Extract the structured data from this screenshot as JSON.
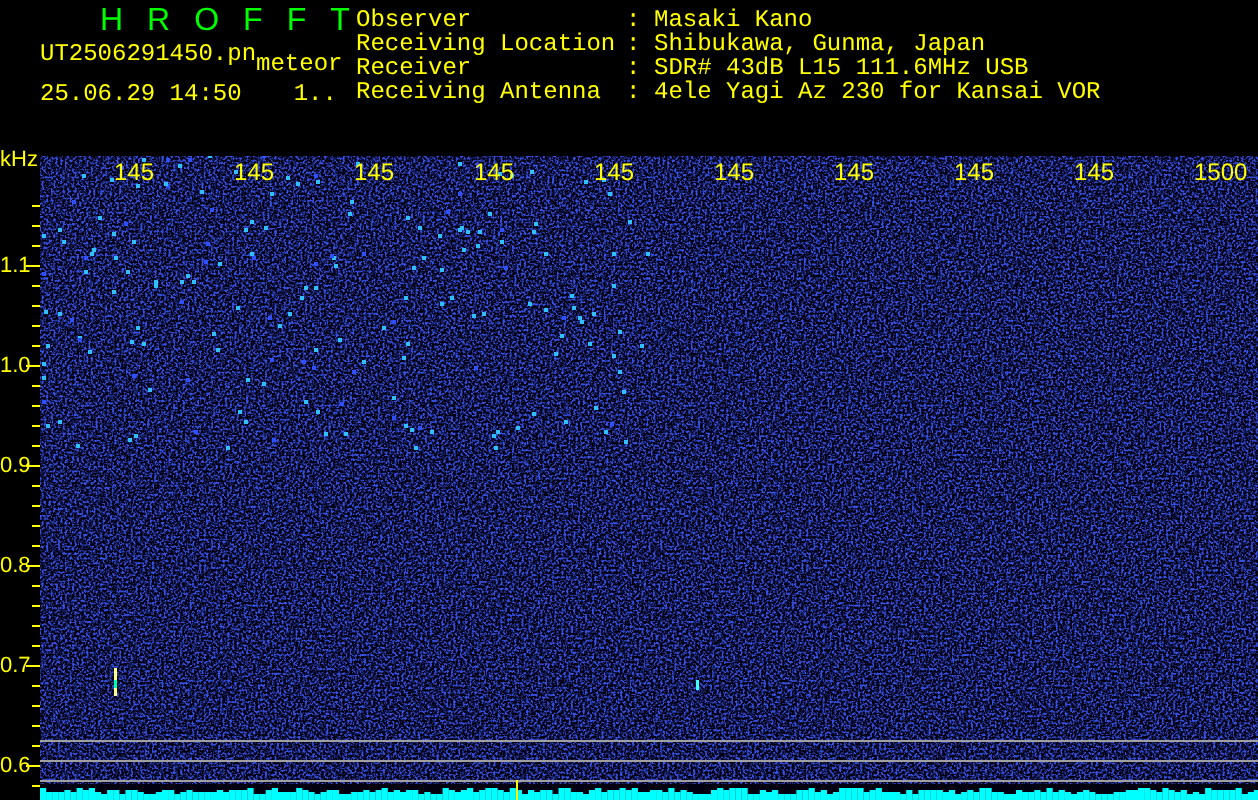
{
  "app_title": "HROFFT",
  "file": {
    "name": "UT2506291450.pn",
    "tag": "meteor",
    "datetime": "25.06.29 14:50",
    "counter": "1.."
  },
  "info": [
    {
      "label": "Observer",
      "colon": ":",
      "value": "Masaki Kano"
    },
    {
      "label": "Receiving Location",
      "colon": ":",
      "value": "Shibukawa, Gunma, Japan"
    },
    {
      "label": "Receiver",
      "colon": ":",
      "value": "SDR# 43dB L15 111.6MHz USB"
    },
    {
      "label": "Receiving Antenna",
      "colon": ":",
      "value": "4ele Yagi Az 230 for Kansai VOR"
    }
  ],
  "x_axis": {
    "unit": "kHz",
    "ticks": [
      "145",
      "145",
      "145",
      "145",
      "145",
      "145",
      "145",
      "145",
      "145",
      "1500"
    ]
  },
  "y_axis": {
    "ticks": [
      "1.1",
      "1.0",
      "0.9",
      "0.8",
      "0.7",
      "0.6"
    ]
  }
}
